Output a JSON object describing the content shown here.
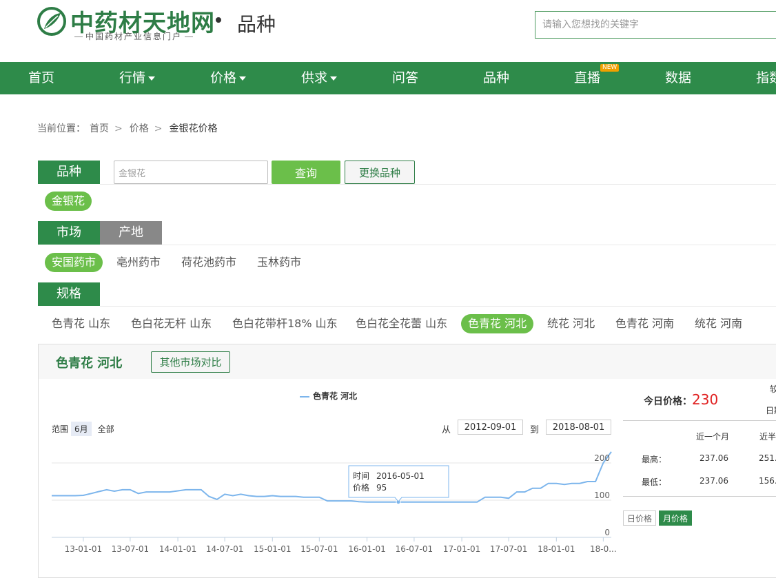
{
  "header": {
    "logo_text": "中药材天地网",
    "logo_sub": "中国药材产业信息门户",
    "section_title": "品种",
    "search_placeholder": "请输入您想找的关键字"
  },
  "nav": {
    "items": [
      {
        "label": "首页",
        "has_menu": false
      },
      {
        "label": "行情",
        "has_menu": true
      },
      {
        "label": "价格",
        "has_menu": true
      },
      {
        "label": "供求",
        "has_menu": true
      },
      {
        "label": "问答",
        "has_menu": false
      },
      {
        "label": "品种",
        "has_menu": false
      },
      {
        "label": "直播",
        "has_menu": false,
        "badge": "NEW"
      },
      {
        "label": "数据",
        "has_menu": false
      },
      {
        "label": "指数",
        "has_menu": false
      }
    ]
  },
  "breadcrumb": {
    "prefix": "当前位置：",
    "items": [
      "首页",
      "价格",
      "金银花价格"
    ]
  },
  "variety": {
    "label": "品种",
    "input_value": "金银花",
    "query_button": "查询",
    "change_button": "更换品种",
    "selected": "金银花"
  },
  "market": {
    "tab_market": "市场",
    "tab_origin": "产地",
    "items": [
      "安国药市",
      "亳州药市",
      "荷花池药市",
      "玉林药市"
    ],
    "active_index": 0
  },
  "spec": {
    "label": "规格",
    "items": [
      "色青花 山东",
      "色白花无杆 山东",
      "色白花带杆18% 山东",
      "色白花全花蕾 山东",
      "色青花 河北",
      "统花 河北",
      "色青花 河南",
      "统花 河南"
    ],
    "active_index": 4
  },
  "panel": {
    "title": "色青花 河北",
    "compare_button": "其他市场对比",
    "range_label": "范围",
    "range_6m": "6月",
    "range_all": "全部",
    "from_label": "从",
    "from_date": "2012-09-01",
    "to_label": "到",
    "to_date": "2018-08-01",
    "tooltip_time_label": "时间",
    "tooltip_time": "2016-05-01",
    "tooltip_price_label": "价格",
    "tooltip_price": "95"
  },
  "side": {
    "today_label": "今日价格：",
    "today_value": "230",
    "col_month": "近一个月",
    "col_half": "近半",
    "row_high": "最高：",
    "row_low": "最低：",
    "high_month": "237.06",
    "high_half": "251.",
    "low_month": "237.06",
    "low_half": "156.",
    "cut_top": "较",
    "cut_date": "日期",
    "toggle_day": "日价格",
    "toggle_month": "月价格"
  },
  "chart_data": {
    "type": "line",
    "series": [
      {
        "name": "色青花 河北",
        "x": [
          "2012-09-01",
          "2012-10-01",
          "2012-11-01",
          "2012-12-01",
          "2013-01-01",
          "2013-02-01",
          "2013-03-01",
          "2013-04-01",
          "2013-05-01",
          "2013-06-01",
          "2013-07-01",
          "2013-08-01",
          "2013-09-01",
          "2013-10-01",
          "2013-11-01",
          "2013-12-01",
          "2014-01-01",
          "2014-02-01",
          "2014-03-01",
          "2014-04-01",
          "2014-05-01",
          "2014-06-01",
          "2014-07-01",
          "2014-08-01",
          "2014-09-01",
          "2014-10-01",
          "2014-11-01",
          "2014-12-01",
          "2015-01-01",
          "2015-02-01",
          "2015-03-01",
          "2015-04-01",
          "2015-05-01",
          "2015-06-01",
          "2015-07-01",
          "2015-08-01",
          "2015-09-01",
          "2015-10-01",
          "2015-11-01",
          "2015-12-01",
          "2016-01-01",
          "2016-02-01",
          "2016-03-01",
          "2016-04-01",
          "2016-05-01",
          "2016-06-01",
          "2016-07-01",
          "2016-08-01",
          "2016-09-01",
          "2016-10-01",
          "2016-11-01",
          "2016-12-01",
          "2017-01-01",
          "2017-02-01",
          "2017-03-01",
          "2017-04-01",
          "2017-05-01",
          "2017-06-01",
          "2017-07-01",
          "2017-08-01",
          "2017-09-01",
          "2017-10-01",
          "2017-11-01",
          "2017-12-01",
          "2018-01-01",
          "2018-02-01",
          "2018-03-01",
          "2018-04-01",
          "2018-05-01",
          "2018-06-01",
          "2018-07-01",
          "2018-08-01"
        ],
        "values": [
          112,
          112,
          112,
          112,
          113,
          118,
          123,
          128,
          124,
          128,
          128,
          118,
          122,
          122,
          122,
          122,
          125,
          128,
          128,
          128,
          110,
          102,
          116,
          112,
          116,
          112,
          110,
          110,
          112,
          110,
          110,
          110,
          108,
          108,
          108,
          98,
          98,
          98,
          98,
          96,
          95,
          95,
          95,
          95,
          95,
          95,
          95,
          95,
          95,
          95,
          95,
          95,
          95,
          95,
          95,
          108,
          108,
          108,
          105,
          122,
          122,
          132,
          132,
          145,
          145,
          142,
          145,
          145,
          150,
          150,
          200,
          230
        ]
      }
    ],
    "xticks": [
      "13-01-01",
      "13-07-01",
      "14-01-01",
      "14-07-01",
      "15-01-01",
      "15-07-01",
      "16-01-01",
      "16-07-01",
      "17-01-01",
      "17-07-01",
      "18-01-01",
      "18-0..."
    ],
    "yticks": [
      0,
      100,
      200
    ],
    "ylim": [
      0,
      250
    ],
    "grid": true,
    "legend": "top-center"
  }
}
